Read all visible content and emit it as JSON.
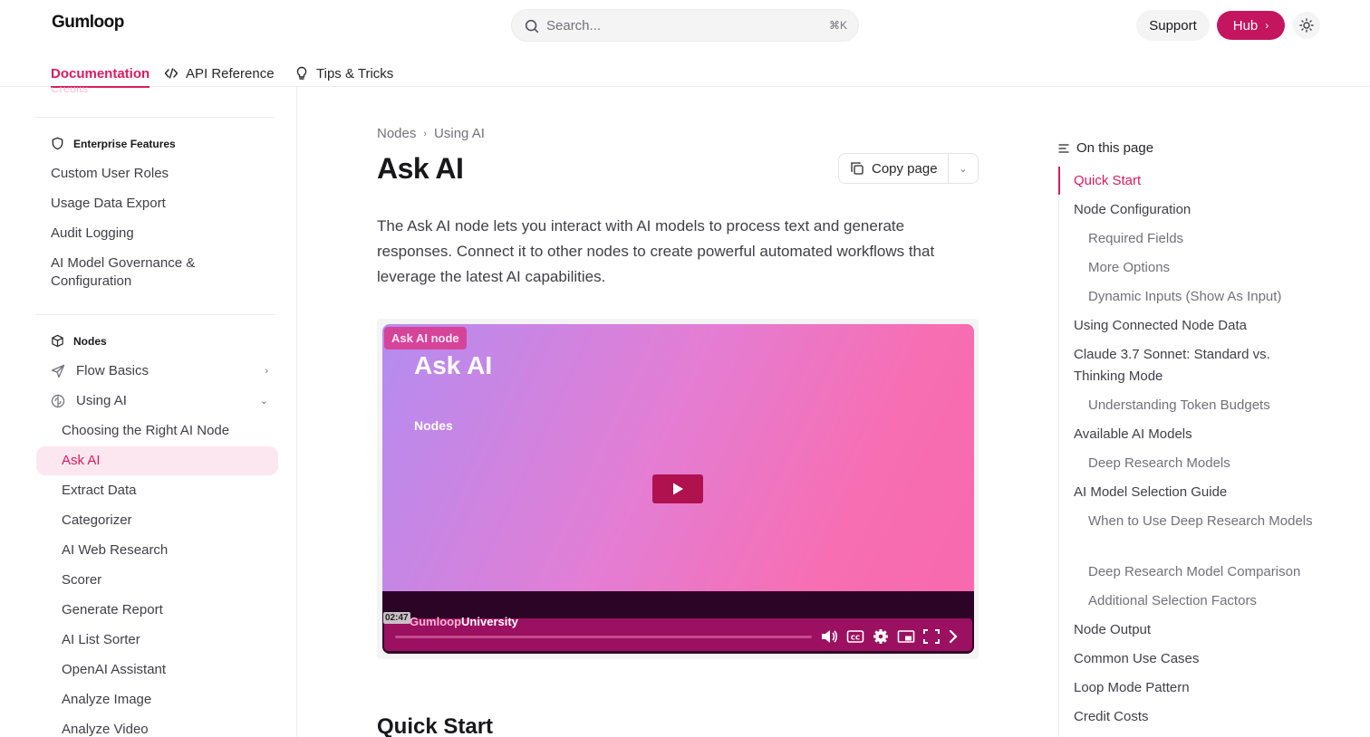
{
  "header": {
    "logo": "Gumloop",
    "search_placeholder": "Search...",
    "search_shortcut": "⌘K",
    "support_label": "Support",
    "hub_label": "Hub",
    "hub_icon": "chevron-right-icon",
    "theme_icon": "sun-icon"
  },
  "tabs": [
    {
      "label": "Documentation",
      "active": true
    },
    {
      "label": "API Reference",
      "icon": "code-icon"
    },
    {
      "label": "Tips & Tricks",
      "icon": "lightbulb-icon"
    }
  ],
  "sidebar": {
    "faded_item": "Credits",
    "enterprise": {
      "heading": "Enterprise Features",
      "items": [
        "Custom User Roles",
        "Usage Data Export",
        "Audit Logging",
        "AI Model Governance & Configuration"
      ]
    },
    "nodes": {
      "heading": "Nodes",
      "groups": [
        {
          "label": "Flow Basics",
          "expanded": false
        },
        {
          "label": "Using AI",
          "expanded": true
        }
      ],
      "using_ai_items": [
        "Choosing the Right AI Node",
        "Ask AI",
        "Extract Data",
        "Categorizer",
        "AI Web Research",
        "Scorer",
        "Generate Report",
        "AI List Sorter",
        "OpenAI Assistant",
        "Analyze Image",
        "Analyze Video"
      ],
      "active_item": "Ask AI"
    }
  },
  "main": {
    "breadcrumb": [
      "Nodes",
      "Using AI"
    ],
    "title": "Ask AI",
    "copy_label": "Copy page",
    "intro": "The Ask AI node lets you interact with AI models to process text and generate responses. Connect it to other nodes to create powerful automated workflows that leverage the latest AI capabilities.",
    "video": {
      "tag": "Ask AI node",
      "title": "Ask AI",
      "subtitle": "Nodes",
      "brand_a": "Gumloop",
      "brand_b": "University",
      "time": "02:47"
    },
    "section_title": "Quick Start"
  },
  "toc": {
    "heading": "On this page",
    "items": [
      {
        "label": "Quick Start",
        "level": 1,
        "active": true
      },
      {
        "label": "Node Configuration",
        "level": 1
      },
      {
        "label": "Required Fields",
        "level": 2
      },
      {
        "label": "More Options",
        "level": 2
      },
      {
        "label": "Dynamic Inputs (Show As Input)",
        "level": 2
      },
      {
        "label": "Using Connected Node Data",
        "level": 1
      },
      {
        "label": "Claude 3.7 Sonnet: Standard vs. Thinking Mode",
        "level": 1
      },
      {
        "label": "Understanding Token Budgets",
        "level": 2
      },
      {
        "label": "Available AI Models",
        "level": 1
      },
      {
        "label": "Deep Research Models",
        "level": 2
      },
      {
        "label": "AI Model Selection Guide",
        "level": 1
      },
      {
        "label": "When to Use Deep Research Models",
        "level": 2
      },
      {
        "label": "Deep Research Model Comparison",
        "level": 2
      },
      {
        "label": "Additional Selection Factors",
        "level": 2
      },
      {
        "label": "Node Output",
        "level": 1
      },
      {
        "label": "Common Use Cases",
        "level": 1
      },
      {
        "label": "Loop Mode Pattern",
        "level": 1
      },
      {
        "label": "Credit Costs",
        "level": 1
      }
    ]
  },
  "colors": {
    "accent": "#d81b60",
    "hub_button": "#c4155f",
    "active_bg": "#fce7f0"
  }
}
